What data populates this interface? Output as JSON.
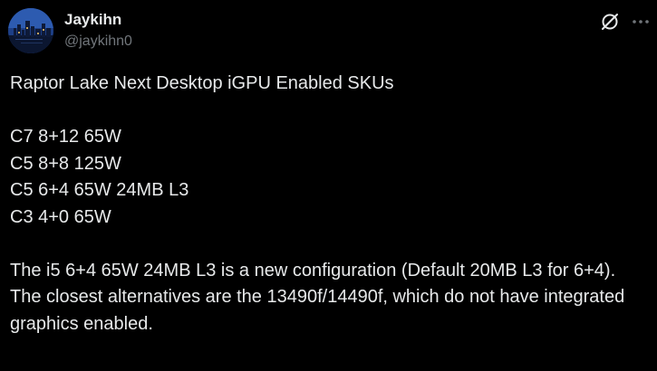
{
  "author": {
    "display_name": "Jaykihn",
    "handle": "@jaykihn0"
  },
  "icons": {
    "grok": "grok-icon",
    "more": "more-horizontal-icon"
  },
  "tweet": {
    "headline": "Raptor Lake Next Desktop iGPU Enabled SKUs",
    "skus": [
      "C7 8+12 65W",
      "C5 8+8 125W",
      "C5 6+4 65W 24MB L3",
      "C3 4+0 65W"
    ],
    "note_1": "The i5 6+4 65W 24MB L3 is a new configuration (Default 20MB L3 for 6+4).",
    "note_2": "The closest alternatives are the 13490f/14490f, which do not have integrated graphics enabled."
  },
  "colors": {
    "background": "#000000",
    "text_primary": "#e7e9ea",
    "text_secondary": "#71767b"
  }
}
